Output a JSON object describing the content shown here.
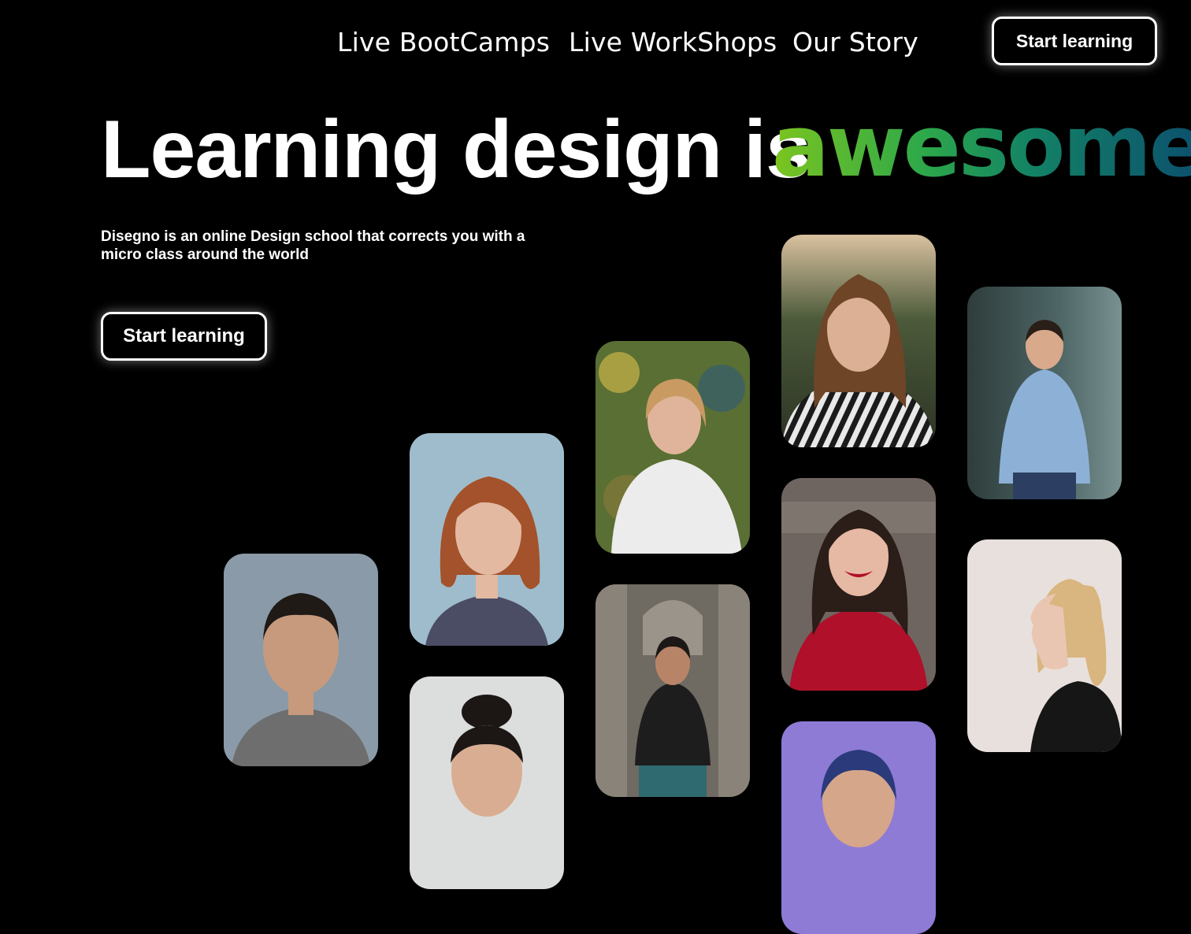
{
  "nav": {
    "links": [
      "Live BootCamps",
      "Live WorkShops",
      "Our Story"
    ],
    "cta_label": "Start learning"
  },
  "hero": {
    "title": "Learning design is",
    "accent": "awesome",
    "accent_gradient": [
      "#7cc51f",
      "#2da84a",
      "#138265",
      "#0b4f6e"
    ],
    "subtitle": "Disegno is an online Design school that corrects you with a micro class around the world",
    "cta_label": "Start learning"
  },
  "photos": [
    {
      "subject": "man-dark-hair-grey-sweater",
      "bg": "#8a9aa8",
      "skin": "#c79a7e",
      "hair": "#1f1a16",
      "shirt": "#6e6e6e"
    },
    {
      "subject": "woman-red-bob-hair",
      "bg": "#9fbccc",
      "skin": "#e3b9a2",
      "hair": "#a3522b",
      "shirt": "#4a4d63"
    },
    {
      "subject": "woman-hair-bun",
      "bg": "#dcdedd",
      "skin": "#d9ad92",
      "hair": "#1c1715",
      "shirt": "#e9e9e9"
    },
    {
      "subject": "woman-white-sweater-outdoors",
      "bg": "#5a6f33",
      "skin": "#e0b49a",
      "hair": "#c99a62",
      "shirt": "#ececec"
    },
    {
      "subject": "man-sitting-fountain",
      "bg": "#6f6a62",
      "skin": "#b88467",
      "hair": "#1b1816",
      "shirt": "#1d1d1d"
    },
    {
      "subject": "woman-striped-shirt-sunset",
      "bg": "#3e4a2e",
      "skin": "#dcb094",
      "hair": "#6e4527",
      "shirt": "#e8e8e8"
    },
    {
      "subject": "woman-red-top-smiling",
      "bg": "#6e6560",
      "skin": "#e6b9a4",
      "hair": "#2b1d17",
      "shirt": "#b0102a"
    },
    {
      "subject": "woman-blue-hair-purple-bg",
      "bg": "#8d7bd6",
      "skin": "#d6a68a",
      "hair": "#2a3a7a",
      "shirt": "#4b3f9a"
    },
    {
      "subject": "man-blue-shirt-smiling",
      "bg": "#4e6666",
      "skin": "#d9a98b",
      "hair": "#2a1f18",
      "shirt": "#8db1d6"
    },
    {
      "subject": "woman-blonde-profile",
      "bg": "#e8e0dc",
      "skin": "#e9c6b2",
      "hair": "#d9b57f",
      "shirt": "#161616"
    }
  ]
}
